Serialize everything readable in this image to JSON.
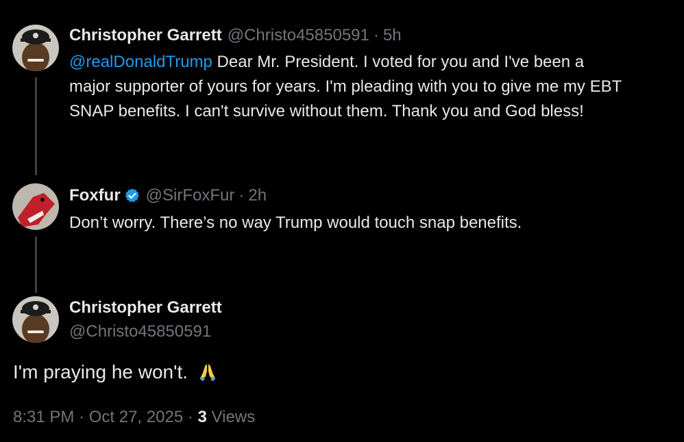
{
  "reply1": {
    "display_name": "Christopher Garrett",
    "handle": "@Christo45850591",
    "separator": "·",
    "time": "5h",
    "mention": "@realDonaldTrump",
    "line1": " Dear Mr. President.  I voted for you and I've been a",
    "line2": "major supporter of yours for years.  I'm pleading with you to give me my EBT",
    "line3": "SNAP benefits.   I can't survive without them. Thank you and God bless!"
  },
  "reply2": {
    "display_name": "Foxfur",
    "handle": "@SirFoxFur",
    "separator": "·",
    "time": "2h",
    "text": "Don’t worry. There’s no way  Trump would touch snap benefits.",
    "verified_icon": "verified-badge-icon"
  },
  "main": {
    "display_name": "Christopher Garrett",
    "handle": "@Christo45850591",
    "text": "I'm praying he won't.",
    "emoji_icon": "folded-hands-icon",
    "time": "8:31 PM",
    "separator": "·",
    "date": "Oct 27, 2025",
    "views_count": "3",
    "views_label": " Views"
  },
  "colors": {
    "background": "#000000",
    "text": "#e7e9ea",
    "secondary": "#71767b",
    "link": "#1d9bf0",
    "thread_line": "#3e4144"
  }
}
